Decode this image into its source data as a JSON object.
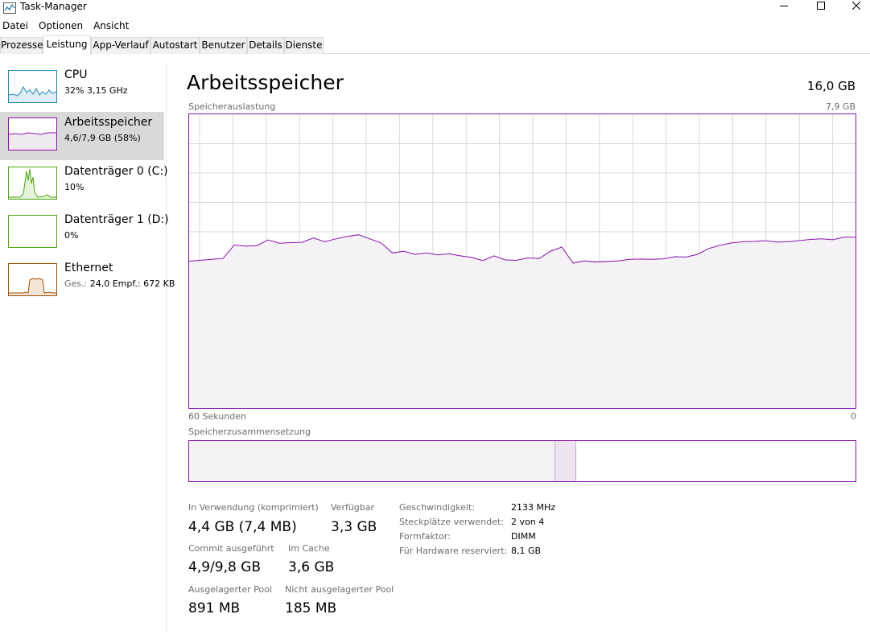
{
  "window": {
    "title": "Task-Manager"
  },
  "menu": [
    "Datei",
    "Optionen",
    "Ansicht"
  ],
  "tabs": [
    {
      "label": "Prozesse",
      "active": false
    },
    {
      "label": "Leistung",
      "active": true
    },
    {
      "label": "App-Verlauf",
      "active": false
    },
    {
      "label": "Autostart",
      "active": false
    },
    {
      "label": "Benutzer",
      "active": false
    },
    {
      "label": "Details",
      "active": false
    },
    {
      "label": "Dienste",
      "active": false
    }
  ],
  "sidebar": {
    "items": [
      {
        "title": "CPU",
        "sub": "32% 3,15 GHz",
        "sub_muted": "",
        "color": "#1e88b8",
        "selected": false
      },
      {
        "title": "Arbeitsspeicher",
        "sub": "4,6/7,9 GB (58%)",
        "sub_muted": "",
        "color": "#8b12ae",
        "selected": true
      },
      {
        "title": "Datenträger 0 (C:)",
        "sub": "10%",
        "sub_muted": "",
        "color": "#4da60c",
        "selected": false
      },
      {
        "title": "Datenträger 1 (D:)",
        "sub": "0%",
        "sub_muted": "",
        "color": "#4da60c",
        "selected": false
      },
      {
        "title": "Ethernet",
        "sub": "24,0 Empf.: 672 KB",
        "sub_muted": "Ges.: ",
        "color": "#a74f01",
        "selected": false
      }
    ]
  },
  "main": {
    "title": "Arbeitsspeicher",
    "total": "16,0 GB",
    "graph_label": "Speicherauslastung",
    "graph_max": "7,9 GB",
    "time_left": "60 Sekunden",
    "time_right": "0",
    "composition_label": "Speicherzusammensetzung",
    "composition": {
      "in_use_fraction": 0.55,
      "modified_fraction": 0.032
    }
  },
  "stats": {
    "in_use_label": "In Verwendung (komprimiert)",
    "in_use_value": "4,4 GB (7,4 MB)",
    "available_label": "Verfügbar",
    "available_value": "3,3 GB",
    "committed_label": "Commit ausgeführt",
    "committed_value": "4,9/9,8 GB",
    "cached_label": "Im Cache",
    "cached_value": "3,6 GB",
    "paged_label": "Ausgelagerter Pool",
    "paged_value": "891 MB",
    "nonpaged_label": "Nicht ausgelagerter Pool",
    "nonpaged_value": "185 MB"
  },
  "specs": [
    {
      "label": "Geschwindigkeit:",
      "value": "2133 MHz"
    },
    {
      "label": "Steckplätze verwendet:",
      "value": "2 von 4"
    },
    {
      "label": "Formfaktor:",
      "value": "DIMM"
    },
    {
      "label": "Für Hardware reserviert:",
      "value": "8,1 GB"
    }
  ],
  "chart_data": {
    "type": "area",
    "title": "",
    "xlabel": "",
    "ylabel": "",
    "x_range_seconds": [
      60,
      0
    ],
    "ylim": [
      0,
      100
    ],
    "values": [
      50,
      50.3,
      50.6,
      50.9,
      55.5,
      55.1,
      55.3,
      57.2,
      56.1,
      56.3,
      56.4,
      57.9,
      56.6,
      57.6,
      58.4,
      59.0,
      57.6,
      56.2,
      52.8,
      53.4,
      52.3,
      52.8,
      52.1,
      52.5,
      51.8,
      51.3,
      50.2,
      51.8,
      50.4,
      50.3,
      51.1,
      50.9,
      53.4,
      54.8,
      49.3,
      50.1,
      49.7,
      49.9,
      50.1,
      50.6,
      50.7,
      50.6,
      50.8,
      51.5,
      51.4,
      52.3,
      54.3,
      55.4,
      56.2,
      56.6,
      56.7,
      57.0,
      56.5,
      56.6,
      57.0,
      57.4,
      57.6,
      57.3,
      58.2,
      58.2
    ]
  },
  "colors": {
    "memory_accent": "#8b12ae",
    "graph_fill": "#f4f2f4",
    "grid": "#d9d9d9"
  }
}
